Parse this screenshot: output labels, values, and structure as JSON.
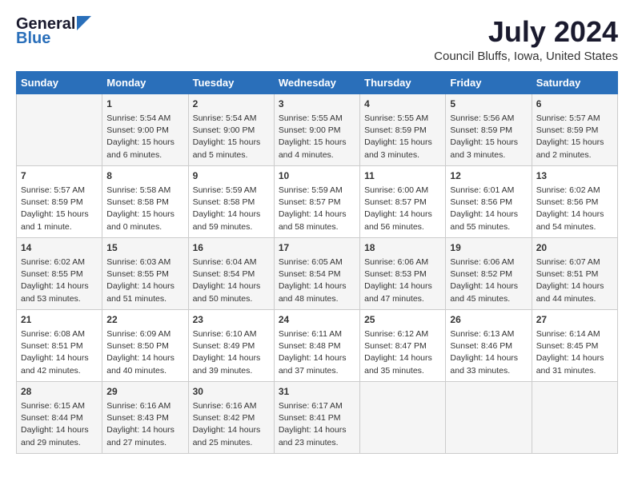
{
  "header": {
    "logo_general": "General",
    "logo_blue": "Blue",
    "month_title": "July 2024",
    "location": "Council Bluffs, Iowa, United States"
  },
  "weekdays": [
    "Sunday",
    "Monday",
    "Tuesday",
    "Wednesday",
    "Thursday",
    "Friday",
    "Saturday"
  ],
  "weeks": [
    [
      {
        "day": "",
        "content": ""
      },
      {
        "day": "1",
        "content": "Sunrise: 5:54 AM\nSunset: 9:00 PM\nDaylight: 15 hours\nand 6 minutes."
      },
      {
        "day": "2",
        "content": "Sunrise: 5:54 AM\nSunset: 9:00 PM\nDaylight: 15 hours\nand 5 minutes."
      },
      {
        "day": "3",
        "content": "Sunrise: 5:55 AM\nSunset: 9:00 PM\nDaylight: 15 hours\nand 4 minutes."
      },
      {
        "day": "4",
        "content": "Sunrise: 5:55 AM\nSunset: 8:59 PM\nDaylight: 15 hours\nand 3 minutes."
      },
      {
        "day": "5",
        "content": "Sunrise: 5:56 AM\nSunset: 8:59 PM\nDaylight: 15 hours\nand 3 minutes."
      },
      {
        "day": "6",
        "content": "Sunrise: 5:57 AM\nSunset: 8:59 PM\nDaylight: 15 hours\nand 2 minutes."
      }
    ],
    [
      {
        "day": "7",
        "content": "Sunrise: 5:57 AM\nSunset: 8:59 PM\nDaylight: 15 hours\nand 1 minute."
      },
      {
        "day": "8",
        "content": "Sunrise: 5:58 AM\nSunset: 8:58 PM\nDaylight: 15 hours\nand 0 minutes."
      },
      {
        "day": "9",
        "content": "Sunrise: 5:59 AM\nSunset: 8:58 PM\nDaylight: 14 hours\nand 59 minutes."
      },
      {
        "day": "10",
        "content": "Sunrise: 5:59 AM\nSunset: 8:57 PM\nDaylight: 14 hours\nand 58 minutes."
      },
      {
        "day": "11",
        "content": "Sunrise: 6:00 AM\nSunset: 8:57 PM\nDaylight: 14 hours\nand 56 minutes."
      },
      {
        "day": "12",
        "content": "Sunrise: 6:01 AM\nSunset: 8:56 PM\nDaylight: 14 hours\nand 55 minutes."
      },
      {
        "day": "13",
        "content": "Sunrise: 6:02 AM\nSunset: 8:56 PM\nDaylight: 14 hours\nand 54 minutes."
      }
    ],
    [
      {
        "day": "14",
        "content": "Sunrise: 6:02 AM\nSunset: 8:55 PM\nDaylight: 14 hours\nand 53 minutes."
      },
      {
        "day": "15",
        "content": "Sunrise: 6:03 AM\nSunset: 8:55 PM\nDaylight: 14 hours\nand 51 minutes."
      },
      {
        "day": "16",
        "content": "Sunrise: 6:04 AM\nSunset: 8:54 PM\nDaylight: 14 hours\nand 50 minutes."
      },
      {
        "day": "17",
        "content": "Sunrise: 6:05 AM\nSunset: 8:54 PM\nDaylight: 14 hours\nand 48 minutes."
      },
      {
        "day": "18",
        "content": "Sunrise: 6:06 AM\nSunset: 8:53 PM\nDaylight: 14 hours\nand 47 minutes."
      },
      {
        "day": "19",
        "content": "Sunrise: 6:06 AM\nSunset: 8:52 PM\nDaylight: 14 hours\nand 45 minutes."
      },
      {
        "day": "20",
        "content": "Sunrise: 6:07 AM\nSunset: 8:51 PM\nDaylight: 14 hours\nand 44 minutes."
      }
    ],
    [
      {
        "day": "21",
        "content": "Sunrise: 6:08 AM\nSunset: 8:51 PM\nDaylight: 14 hours\nand 42 minutes."
      },
      {
        "day": "22",
        "content": "Sunrise: 6:09 AM\nSunset: 8:50 PM\nDaylight: 14 hours\nand 40 minutes."
      },
      {
        "day": "23",
        "content": "Sunrise: 6:10 AM\nSunset: 8:49 PM\nDaylight: 14 hours\nand 39 minutes."
      },
      {
        "day": "24",
        "content": "Sunrise: 6:11 AM\nSunset: 8:48 PM\nDaylight: 14 hours\nand 37 minutes."
      },
      {
        "day": "25",
        "content": "Sunrise: 6:12 AM\nSunset: 8:47 PM\nDaylight: 14 hours\nand 35 minutes."
      },
      {
        "day": "26",
        "content": "Sunrise: 6:13 AM\nSunset: 8:46 PM\nDaylight: 14 hours\nand 33 minutes."
      },
      {
        "day": "27",
        "content": "Sunrise: 6:14 AM\nSunset: 8:45 PM\nDaylight: 14 hours\nand 31 minutes."
      }
    ],
    [
      {
        "day": "28",
        "content": "Sunrise: 6:15 AM\nSunset: 8:44 PM\nDaylight: 14 hours\nand 29 minutes."
      },
      {
        "day": "29",
        "content": "Sunrise: 6:16 AM\nSunset: 8:43 PM\nDaylight: 14 hours\nand 27 minutes."
      },
      {
        "day": "30",
        "content": "Sunrise: 6:16 AM\nSunset: 8:42 PM\nDaylight: 14 hours\nand 25 minutes."
      },
      {
        "day": "31",
        "content": "Sunrise: 6:17 AM\nSunset: 8:41 PM\nDaylight: 14 hours\nand 23 minutes."
      },
      {
        "day": "",
        "content": ""
      },
      {
        "day": "",
        "content": ""
      },
      {
        "day": "",
        "content": ""
      }
    ]
  ]
}
